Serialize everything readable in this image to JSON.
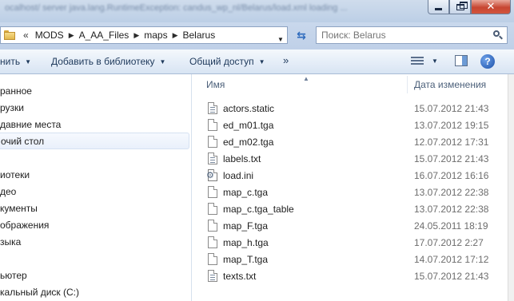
{
  "window": {
    "title_blurred": "ocalhost/ server java.lang.RuntimeException: candus_wp_nl/Belarus/load.xml loading ...",
    "close_glyph": "✕"
  },
  "address": {
    "overflow": "«",
    "crumbs": [
      "MODS",
      "A_AA_Files",
      "maps",
      "Belarus"
    ],
    "refresh_glyph": "⇆"
  },
  "search": {
    "placeholder": "Поиск: Belarus"
  },
  "toolbar": {
    "organize_label": "нить",
    "library_label": "Добавить в библиотеку",
    "share_label": "Общий доступ",
    "more_label": "»",
    "help_glyph": "?"
  },
  "nav": {
    "items": [
      "ранное",
      "рузки",
      "давние места",
      "очий стол",
      "иотеки",
      "део",
      "кументы",
      "ображения",
      "зыка",
      "ьютер",
      "кальный диск (C:)"
    ]
  },
  "columns": {
    "name": "Имя",
    "date": "Дата изменения"
  },
  "files": [
    {
      "name": "actors.static",
      "date": "15.07.2012 21:43",
      "icon": "text-file-icon"
    },
    {
      "name": "ed_m01.tga",
      "date": "13.07.2012 19:15",
      "icon": "file-icon"
    },
    {
      "name": "ed_m02.tga",
      "date": "12.07.2012 17:31",
      "icon": "file-icon"
    },
    {
      "name": "labels.txt",
      "date": "15.07.2012 21:43",
      "icon": "text-file-icon"
    },
    {
      "name": "load.ini",
      "date": "16.07.2012 16:16",
      "icon": "settings-file-icon"
    },
    {
      "name": "map_c.tga",
      "date": "13.07.2012 22:38",
      "icon": "file-icon"
    },
    {
      "name": "map_c.tga_table",
      "date": "13.07.2012 22:38",
      "icon": "file-icon"
    },
    {
      "name": "map_F.tga",
      "date": "24.05.2011 18:19",
      "icon": "file-icon"
    },
    {
      "name": "map_h.tga",
      "date": "17.07.2012 2:27",
      "icon": "file-icon"
    },
    {
      "name": "map_T.tga",
      "date": "14.07.2012 17:12",
      "icon": "file-icon"
    },
    {
      "name": "texts.txt",
      "date": "15.07.2012 21:43",
      "icon": "text-file-icon"
    }
  ]
}
